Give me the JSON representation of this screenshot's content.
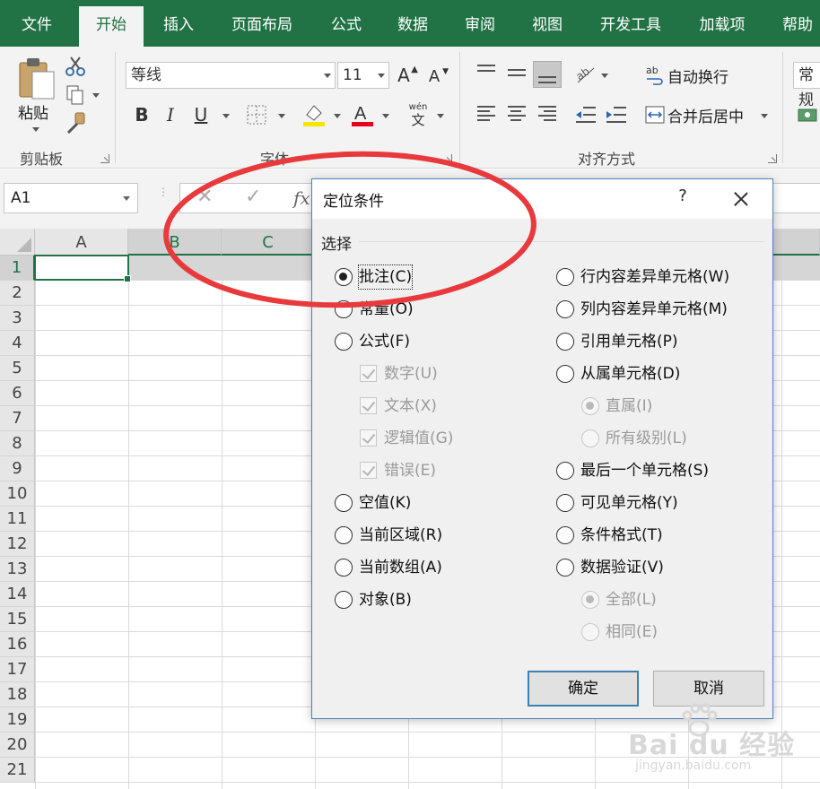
{
  "tabs": [
    {
      "label": "文件",
      "active": false
    },
    {
      "label": "开始",
      "active": true
    },
    {
      "label": "插入",
      "active": false
    },
    {
      "label": "页面布局",
      "active": false
    },
    {
      "label": "公式",
      "active": false
    },
    {
      "label": "数据",
      "active": false
    },
    {
      "label": "审阅",
      "active": false
    },
    {
      "label": "视图",
      "active": false
    },
    {
      "label": "开发工具",
      "active": false
    },
    {
      "label": "加载项",
      "active": false
    },
    {
      "label": "帮助",
      "active": false
    }
  ],
  "ribbon": {
    "clipboard": {
      "paste_label": "粘贴",
      "group_label": "剪贴板"
    },
    "font": {
      "font_name": "等线",
      "font_size": "11",
      "group_label": "字体",
      "bold": "B",
      "italic": "I",
      "underline": "U",
      "grow": "A",
      "shrink": "A",
      "phonetic_top": "wén",
      "phonetic_bottom": "文"
    },
    "alignment": {
      "wrap_text": "自动换行",
      "merge_center": "合并后居中",
      "group_label": "对齐方式"
    },
    "number": {
      "format": "常规"
    }
  },
  "formula_bar": {
    "name_box": "A1",
    "fx": "fx",
    "cancel": "✕",
    "enter": "✓"
  },
  "grid": {
    "columns": [
      "A",
      "B",
      "C"
    ],
    "rows": [
      "1",
      "2",
      "3",
      "4",
      "5",
      "6",
      "7",
      "8",
      "9",
      "10",
      "11",
      "12",
      "13",
      "14",
      "15",
      "16",
      "17",
      "18",
      "19",
      "20",
      "21"
    ]
  },
  "dialog": {
    "title": "定位条件",
    "help": "?",
    "group_label": "选择",
    "left_options": [
      {
        "label": "批注(C)",
        "kind": "radio",
        "checked": true,
        "disabled": false
      },
      {
        "label": "常量(O)",
        "kind": "radio",
        "checked": false,
        "disabled": false
      },
      {
        "label": "公式(F)",
        "kind": "radio",
        "checked": false,
        "disabled": false
      },
      {
        "label": "数字(U)",
        "kind": "checkbox",
        "checked": true,
        "disabled": true
      },
      {
        "label": "文本(X)",
        "kind": "checkbox",
        "checked": true,
        "disabled": true
      },
      {
        "label": "逻辑值(G)",
        "kind": "checkbox",
        "checked": true,
        "disabled": true
      },
      {
        "label": "错误(E)",
        "kind": "checkbox",
        "checked": true,
        "disabled": true
      },
      {
        "label": "空值(K)",
        "kind": "radio",
        "checked": false,
        "disabled": false
      },
      {
        "label": "当前区域(R)",
        "kind": "radio",
        "checked": false,
        "disabled": false
      },
      {
        "label": "当前数组(A)",
        "kind": "radio",
        "checked": false,
        "disabled": false
      },
      {
        "label": "对象(B)",
        "kind": "radio",
        "checked": false,
        "disabled": false
      }
    ],
    "right_options": [
      {
        "label": "行内容差异单元格(W)",
        "kind": "radio",
        "checked": false,
        "disabled": false
      },
      {
        "label": "列内容差异单元格(M)",
        "kind": "radio",
        "checked": false,
        "disabled": false
      },
      {
        "label": "引用单元格(P)",
        "kind": "radio",
        "checked": false,
        "disabled": false
      },
      {
        "label": "从属单元格(D)",
        "kind": "radio",
        "checked": false,
        "disabled": false
      },
      {
        "label": "直属(I)",
        "kind": "radio",
        "checked": true,
        "disabled": true
      },
      {
        "label": "所有级别(L)",
        "kind": "radio",
        "checked": false,
        "disabled": true
      },
      {
        "label": "最后一个单元格(S)",
        "kind": "radio",
        "checked": false,
        "disabled": false
      },
      {
        "label": "可见单元格(Y)",
        "kind": "radio",
        "checked": false,
        "disabled": false
      },
      {
        "label": "条件格式(T)",
        "kind": "radio",
        "checked": false,
        "disabled": false
      },
      {
        "label": "数据验证(V)",
        "kind": "radio",
        "checked": false,
        "disabled": false
      },
      {
        "label": "全部(L)",
        "kind": "radio",
        "checked": true,
        "disabled": true
      },
      {
        "label": "相同(E)",
        "kind": "radio",
        "checked": false,
        "disabled": true
      }
    ],
    "ok_label": "确定",
    "cancel_label": "取消"
  },
  "watermark": {
    "logo": "Bai du 经验",
    "url": "jingyan.baidu.com"
  },
  "colors": {
    "excel_green": "#217346",
    "annotation_red": "#e8393c",
    "dialog_border": "#4f81bd"
  }
}
